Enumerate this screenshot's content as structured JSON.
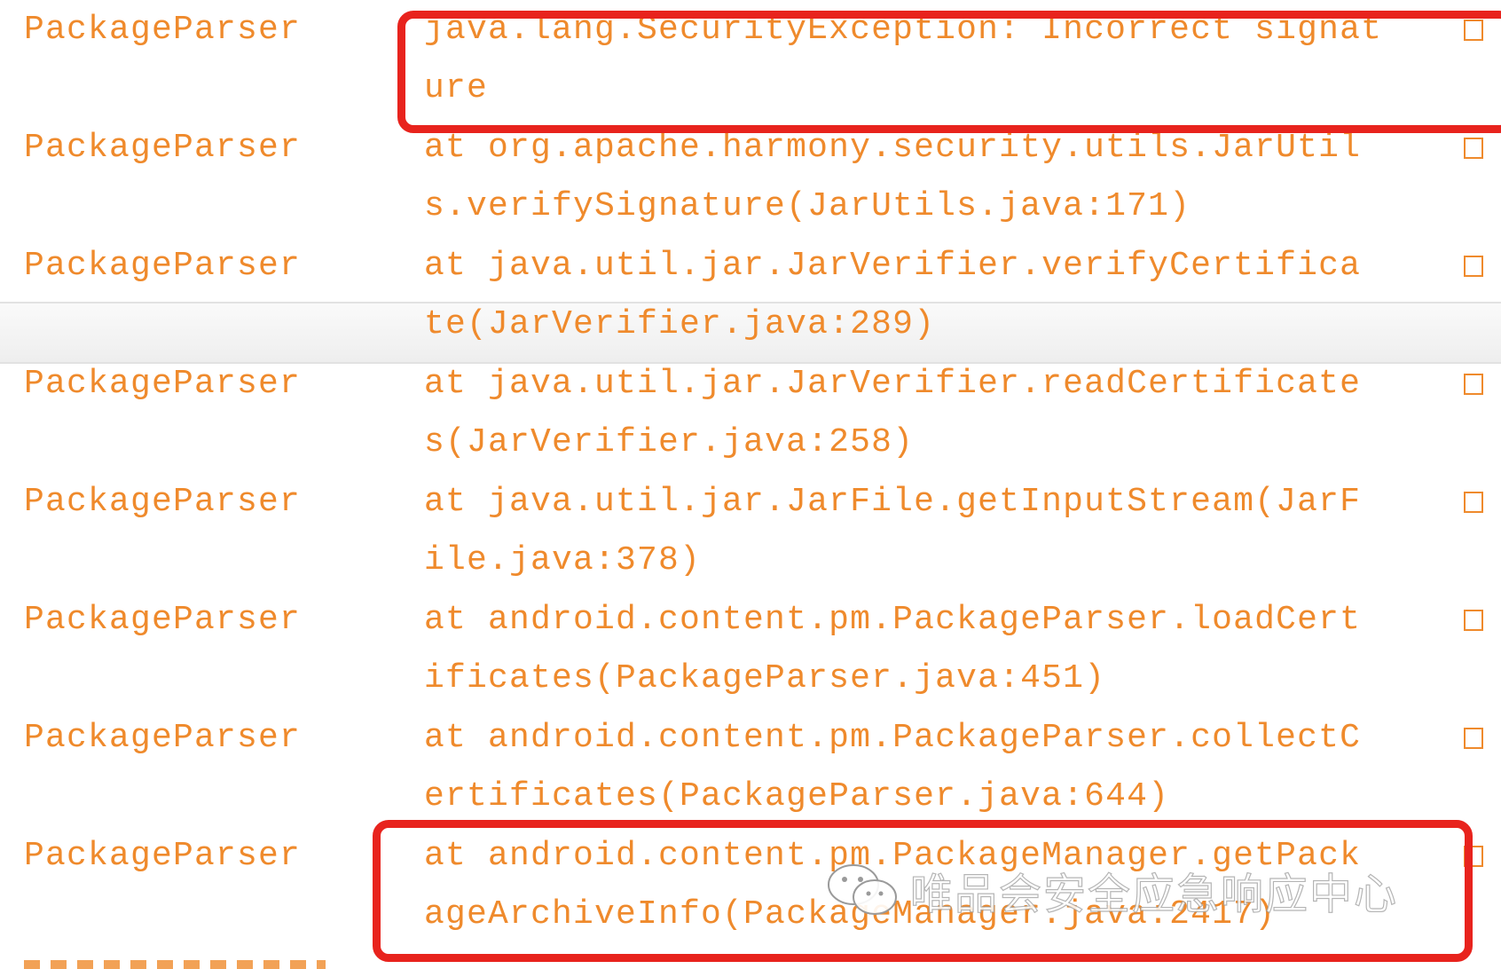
{
  "log": {
    "entries": [
      {
        "tag": "PackageParser",
        "line1": "java.lang.SecurityException: Incorrect signat",
        "line2": "ure"
      },
      {
        "tag": "PackageParser",
        "line1": "at org.apache.harmony.security.utils.JarUtil",
        "line2": "s.verifySignature(JarUtils.java:171)"
      },
      {
        "tag": "PackageParser",
        "line1": "at java.util.jar.JarVerifier.verifyCertifica",
        "line2": "te(JarVerifier.java:289)"
      },
      {
        "tag": "PackageParser",
        "line1": "at java.util.jar.JarVerifier.readCertificate",
        "line2": "s(JarVerifier.java:258)"
      },
      {
        "tag": "PackageParser",
        "line1": "at java.util.jar.JarFile.getInputStream(JarF",
        "line2": "ile.java:378)"
      },
      {
        "tag": "PackageParser",
        "line1": "at android.content.pm.PackageParser.loadCert",
        "line2": "ificates(PackageParser.java:451)"
      },
      {
        "tag": "PackageParser",
        "line1": "at android.content.pm.PackageParser.collectC",
        "line2": "ertificates(PackageParser.java:644)"
      },
      {
        "tag": "PackageParser",
        "line1": "at android.content.pm.PackageManager.getPack",
        "line2": "ageArchiveInfo(PackageManager.java:2417)"
      }
    ]
  },
  "watermark": {
    "text": "唯品会安全应急响应中心",
    "icon": "wechat-icon"
  },
  "colors": {
    "log_text": "#ef8a2c",
    "highlight_box": "#e8231d",
    "selected_row": "#eeeeee"
  }
}
